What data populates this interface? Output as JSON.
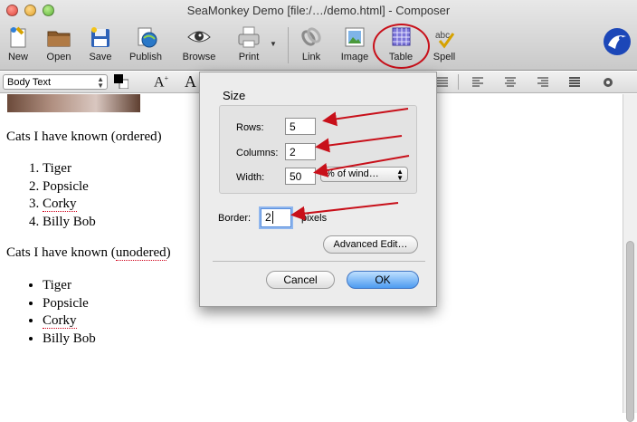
{
  "window": {
    "title": "SeaMonkey Demo [file:/…/demo.html] - Composer"
  },
  "toolbar": {
    "buttons": [
      {
        "id": "new",
        "label": "New"
      },
      {
        "id": "open",
        "label": "Open"
      },
      {
        "id": "save",
        "label": "Save"
      },
      {
        "id": "publish",
        "label": "Publish"
      },
      {
        "id": "browse",
        "label": "Browse"
      },
      {
        "id": "print",
        "label": "Print"
      },
      {
        "id": "link",
        "label": "Link"
      },
      {
        "id": "image",
        "label": "Image"
      },
      {
        "id": "table",
        "label": "Table"
      },
      {
        "id": "spell",
        "label": "Spell"
      }
    ]
  },
  "formatbar": {
    "paragraph_style": "Body Text"
  },
  "document": {
    "heading_ordered": "Cats I have known (ordered)",
    "ordered_items": [
      "Tiger",
      "Popsicle",
      "Corky",
      "Billy Bob"
    ],
    "heading_unordered_prefix": "Cats I have known (",
    "heading_unordered_word": "unodered",
    "heading_unordered_suffix": ")",
    "unordered_items": [
      "Tiger",
      "Popsicle",
      "Corky",
      "Billy Bob"
    ]
  },
  "dialog": {
    "section_title": "Size",
    "rows_label": "Rows:",
    "rows_value": "5",
    "columns_label": "Columns:",
    "columns_value": "2",
    "width_label": "Width:",
    "width_value": "50",
    "width_units": "% of wind…",
    "border_label": "Border:",
    "border_value": "2",
    "border_units": "pixels",
    "advanced_edit": "Advanced Edit…",
    "cancel": "Cancel",
    "ok": "OK"
  },
  "colors": {
    "annotation_red": "#c8101a",
    "accent_blue": "#4d9bf0"
  }
}
